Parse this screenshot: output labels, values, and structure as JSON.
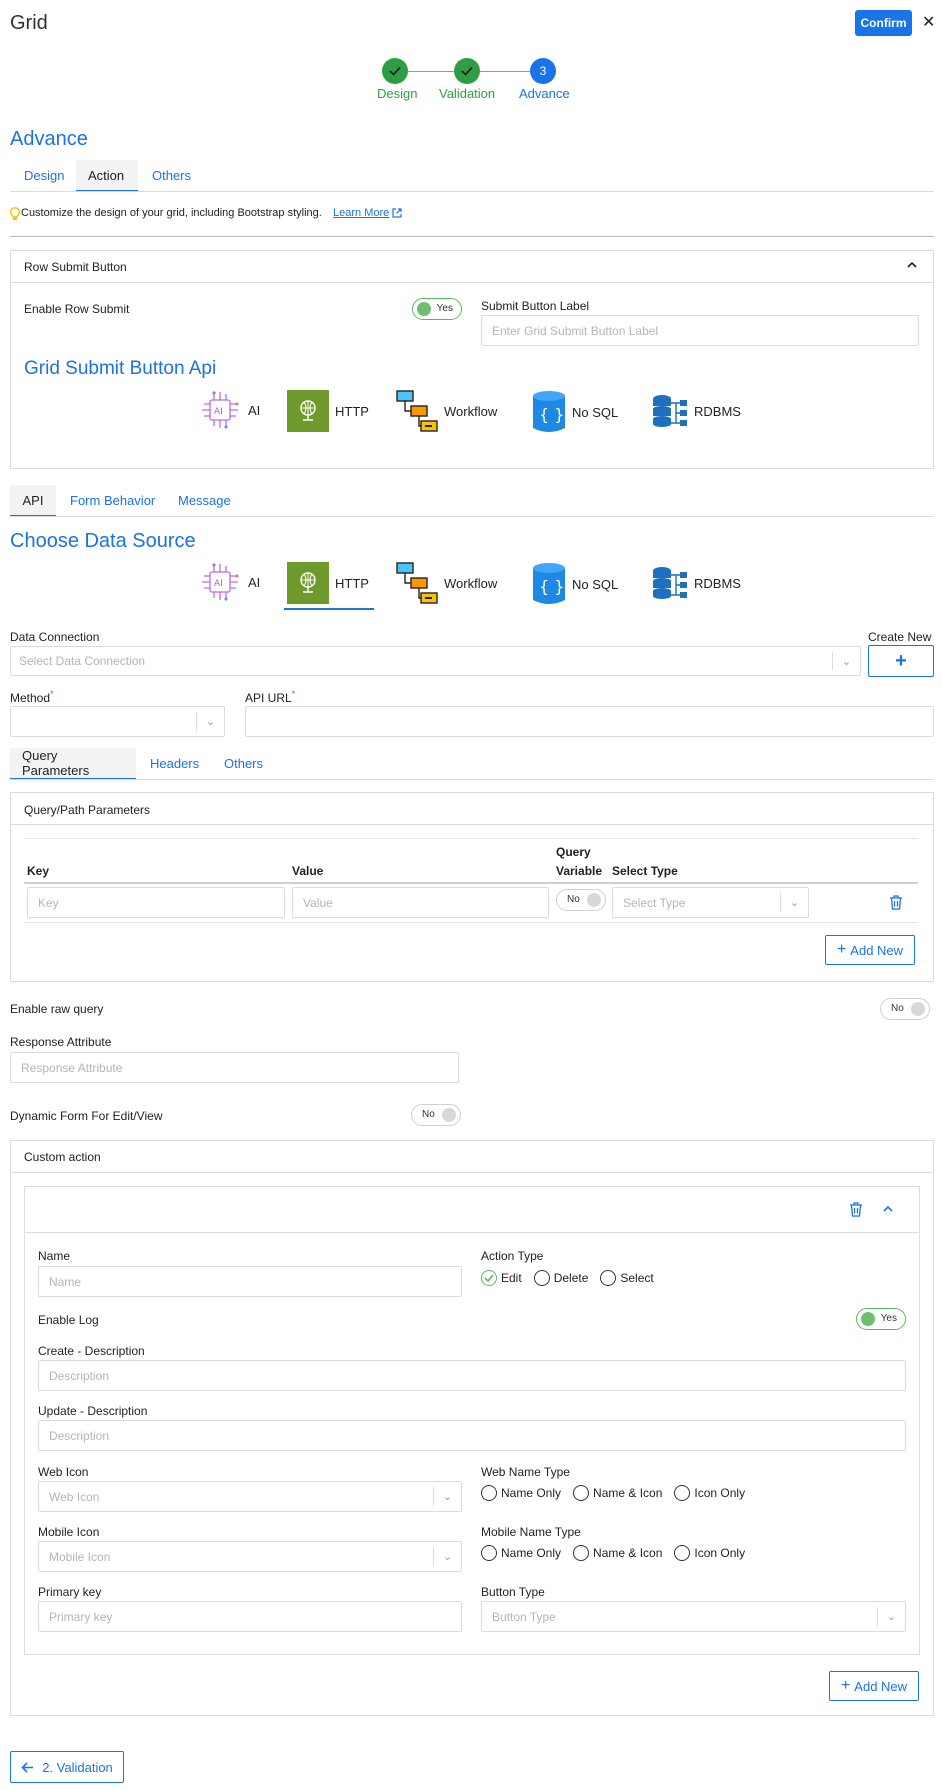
{
  "header": {
    "title": "Grid",
    "confirm_label": "Confirm",
    "close_glyph": "✕"
  },
  "stepper": {
    "steps": [
      {
        "label": "Design",
        "state": "done"
      },
      {
        "label": "Validation",
        "state": "done"
      },
      {
        "label": "Advance",
        "number": "3",
        "state": "active"
      }
    ]
  },
  "section_title": "Advance",
  "main_tabs": [
    "Design",
    "Action",
    "Others"
  ],
  "info": {
    "text": "Customize the design of your grid, including Bootstrap styling.",
    "link": "Learn More"
  },
  "row_submit": {
    "panel_title": "Row Submit Button",
    "enable_label": "Enable Row Submit",
    "enable_value": "Yes",
    "submit_label_title": "Submit Button Label",
    "submit_label_placeholder": "Enter Grid Submit Button Label",
    "api_title": "Grid Submit Button Api",
    "sources": [
      "AI",
      "HTTP",
      "Workflow",
      "No SQL",
      "RDBMS"
    ]
  },
  "api_tabs": [
    "API",
    "Form Behavior",
    "Message"
  ],
  "data_source": {
    "title": "Choose Data Source",
    "sources": [
      "AI",
      "HTTP",
      "Workflow",
      "No SQL",
      "RDBMS"
    ],
    "selected": "HTTP"
  },
  "connection": {
    "label": "Data Connection",
    "placeholder": "Select Data Connection",
    "create_new": "Create New",
    "plus": "+"
  },
  "method": {
    "label": "Method",
    "required": "*"
  },
  "api_url": {
    "label": "API URL",
    "required": "*"
  },
  "param_tabs": [
    "Query Parameters",
    "Headers",
    "Others"
  ],
  "query_params": {
    "panel_title": "Query/Path Parameters",
    "col_key": "Key",
    "col_value": "Value",
    "col_query_1": "Query",
    "col_query_2": "Variable",
    "col_type": "Select Type",
    "row": {
      "key_ph": "Key",
      "value_ph": "Value",
      "toggle": "No",
      "type_ph": "Select Type"
    },
    "add_new": "Add New"
  },
  "raw_query": {
    "label": "Enable raw query",
    "value": "No"
  },
  "response_attr": {
    "label": "Response Attribute",
    "placeholder": "Response Attribute"
  },
  "dynamic_form": {
    "label": "Dynamic Form For Edit/View",
    "value": "No"
  },
  "custom_action": {
    "panel_title": "Custom action",
    "name_label": "Name",
    "name_ph": "Name",
    "action_type_label": "Action Type",
    "action_types": [
      "Edit",
      "Delete",
      "Select"
    ],
    "enable_log_label": "Enable Log",
    "enable_log_value": "Yes",
    "create_desc_label": "Create - Description",
    "create_desc_ph": "Description",
    "update_desc_label": "Update - Description",
    "update_desc_ph": "Description",
    "web_icon_label": "Web Icon",
    "web_icon_ph": "Web Icon",
    "web_name_type_label": "Web Name Type",
    "name_types": [
      "Name Only",
      "Name & Icon",
      "Icon Only"
    ],
    "mobile_icon_label": "Mobile Icon",
    "mobile_icon_ph": "Mobile Icon",
    "mobile_name_type_label": "Mobile Name Type",
    "primary_key_label": "Primary key",
    "primary_key_ph": "Primary key",
    "button_type_label": "Button Type",
    "button_type_ph": "Button Type",
    "add_new": "Add New"
  },
  "footer": {
    "back_label": "2. Validation"
  },
  "colors": {
    "accent": "#1a73e8",
    "success": "#2e9e44",
    "http_green": "#6d9a2a"
  }
}
